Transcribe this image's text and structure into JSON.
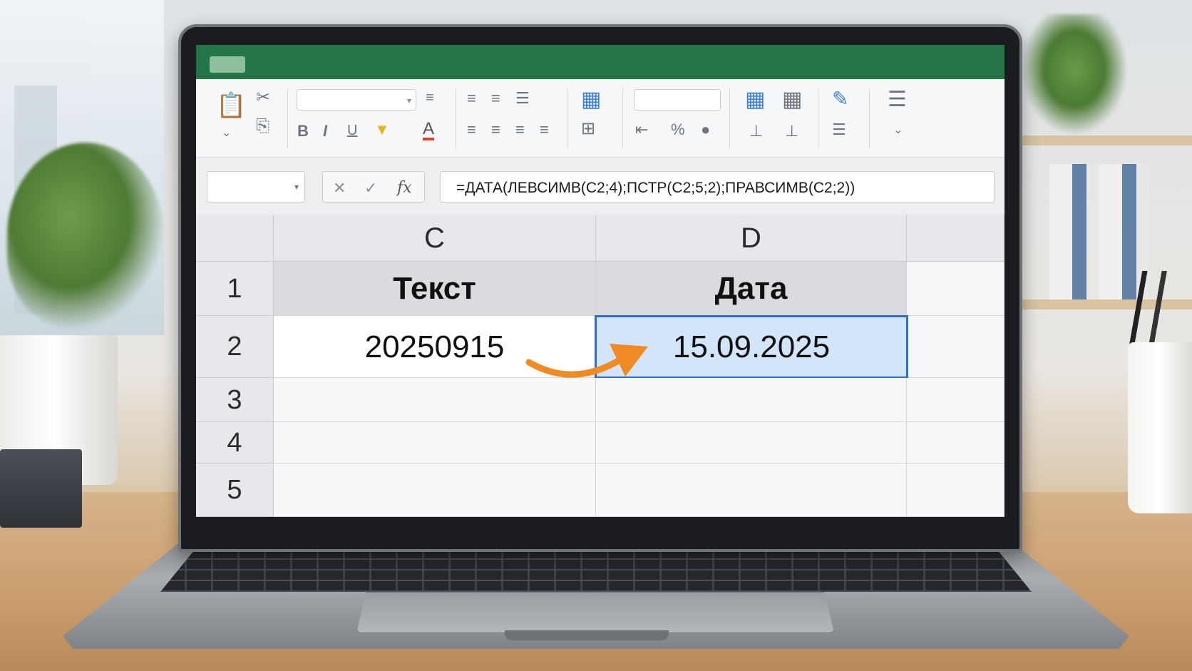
{
  "formula_bar": {
    "formula": "=ДАТА(ЛЕВСИМВ(C2;4);ПСТР(C2;5;2);ПРАВСИМВ(C2;2))",
    "cancel_icon": "✕",
    "enter_icon": "✓",
    "fx_label": "fx"
  },
  "columns": [
    "C",
    "D"
  ],
  "rows": [
    "1",
    "2",
    "3",
    "4",
    "5"
  ],
  "cells": {
    "C1": "Текст",
    "D1": "Дата",
    "C2": "20250915",
    "D2": "15.09.2025"
  },
  "ribbon": {
    "icons": [
      "paste-icon",
      "cut-icon",
      "copy-icon",
      "bold-icon",
      "italic-icon",
      "underline-icon",
      "fill-color-icon",
      "font-color-icon",
      "align-icons",
      "table-icon",
      "borders-icon",
      "number-format-icon",
      "percent-icon",
      "conditional-format-icon",
      "insert-icon",
      "delete-icon",
      "format-painter-icon",
      "more-icon"
    ],
    "bold": "B",
    "italic": "I",
    "underline": "U",
    "font_color": "A",
    "percent": "%"
  },
  "colors": {
    "titlebar": "#237446",
    "selection": "#2f6fc1",
    "selection_fill": "#d3e5fb",
    "arrow": "#f08a24"
  }
}
